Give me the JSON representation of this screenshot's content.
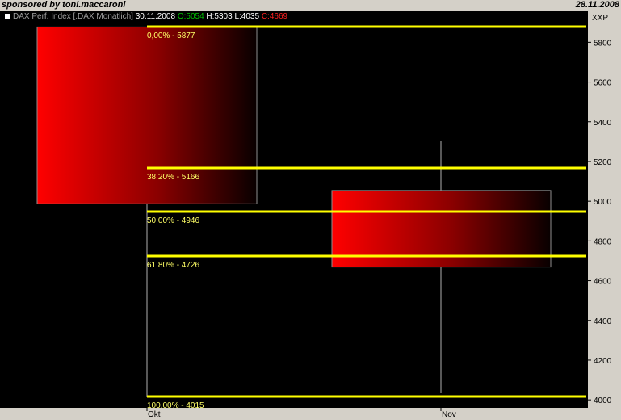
{
  "header": {
    "sponsor": "sponsored by toni.maccaroni",
    "date": "28.11.2008",
    "instrument": "DAX Perf. Index [.DAX  Monatlich]",
    "bar_date": "30.11.2008",
    "open_label": "O:",
    "open": "5054",
    "high_label": "H:",
    "high": "5303",
    "low_label": "L:",
    "low": "4035",
    "close_label": "C:",
    "close": "4669",
    "yaxis_title": "XXP"
  },
  "colors": {
    "background": "#000000",
    "candle_body": "#ff0000",
    "fib_line": "#ffff00",
    "fib_text": "#ffff66",
    "open_text": "#00c000",
    "close_text": "#ff2020"
  },
  "chart_data": {
    "type": "candlestick",
    "title": "DAX Perf. Index [.DAX  Monatlich]",
    "categories": [
      "Okt",
      "Nov"
    ],
    "candles": [
      {
        "period": "Okt",
        "open": 5877,
        "high": 5877,
        "low": 4015,
        "close": 4987
      },
      {
        "period": "Nov",
        "open": 5054,
        "high": 5303,
        "low": 4035,
        "close": 4669
      }
    ],
    "ylim": [
      3960,
      5960
    ],
    "yticks": [
      4000,
      4200,
      4400,
      4600,
      4800,
      5000,
      5200,
      5400,
      5600,
      5800
    ],
    "ytick_labels": [
      "4000",
      "4200",
      "4400",
      "4600",
      "4800",
      "5000",
      "5200",
      "5400",
      "5600",
      "5800"
    ],
    "xtick_labels": [
      "Okt",
      "Nov"
    ],
    "fibonacci_levels": [
      {
        "label": "0,00% - 5877",
        "value": 5877
      },
      {
        "label": "38,20% - 5166",
        "value": 5166
      },
      {
        "label": "50,00% - 4946",
        "value": 4946
      },
      {
        "label": "61,80% - 4726",
        "value": 4726
      },
      {
        "label": "100,00% - 4015",
        "value": 4015
      }
    ]
  }
}
